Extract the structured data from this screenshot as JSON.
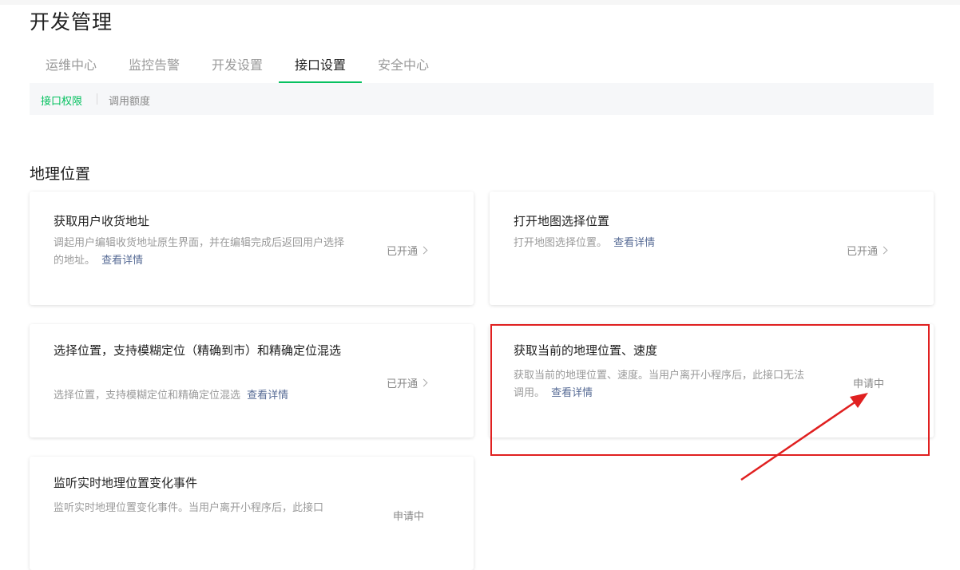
{
  "page": {
    "title": "开发管理"
  },
  "tabs": [
    {
      "label": "运维中心"
    },
    {
      "label": "监控告警"
    },
    {
      "label": "开发设置"
    },
    {
      "label": "接口设置",
      "active": true
    },
    {
      "label": "安全中心"
    }
  ],
  "subnav": [
    {
      "label": "接口权限",
      "active": true
    },
    {
      "label": "调用额度"
    }
  ],
  "section": {
    "title": "地理位置"
  },
  "cards": [
    {
      "title": "获取用户收货地址",
      "desc": "调起用户编辑收货地址原生界面，并在编辑完成后返回用户选择的地址。",
      "link": "查看详情",
      "status": "已开通",
      "has_chevron": true
    },
    {
      "title": "打开地图选择位置",
      "desc": "打开地图选择位置。",
      "link": "查看详情",
      "status": "已开通",
      "has_chevron": true
    },
    {
      "title": "选择位置，支持模糊定位（精确到市）和精确定位混选",
      "desc": "选择位置，支持模糊定位和精确定位混选",
      "link": "查看详情",
      "status": "已开通",
      "has_chevron": true
    },
    {
      "title": "获取当前的地理位置、速度",
      "desc": "获取当前的地理位置、速度。当用户离开小程序后，此接口无法调用。",
      "link": "查看详情",
      "status": "申请中",
      "has_chevron": false
    },
    {
      "title": "监听实时地理位置变化事件",
      "desc": "监听实时地理位置变化事件。当用户离开小程序后，此接口",
      "link": "",
      "status": "申请中",
      "has_chevron": false
    }
  ],
  "annotation": {
    "color": "#e02020"
  }
}
